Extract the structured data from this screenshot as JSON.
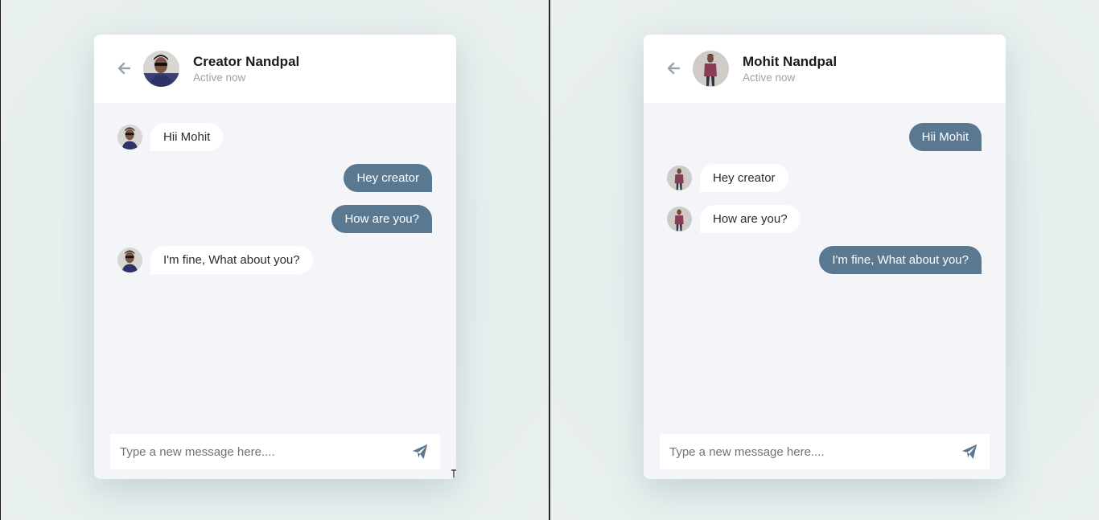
{
  "colors": {
    "outgoing_bubble": "#5b7891",
    "incoming_bubble": "#ffffff",
    "chat_background": "#f3f5f8",
    "accent_icon": "#5b7891"
  },
  "panels": [
    {
      "header": {
        "back_icon": "arrow-left-icon",
        "name": "Creator Nandpal",
        "status": "Active now"
      },
      "messages": [
        {
          "text": "Hii Mohit",
          "direction": "in"
        },
        {
          "text": "Hey creator",
          "direction": "out"
        },
        {
          "text": "How are you?",
          "direction": "out"
        },
        {
          "text": "I'm fine, What about you?",
          "direction": "in"
        }
      ],
      "composer": {
        "placeholder": "Type a new message here....",
        "value": "",
        "send_icon": "paper-plane-icon"
      }
    },
    {
      "header": {
        "back_icon": "arrow-left-icon",
        "name": "Mohit Nandpal",
        "status": "Active now"
      },
      "messages": [
        {
          "text": "Hii Mohit",
          "direction": "out"
        },
        {
          "text": "Hey creator",
          "direction": "in"
        },
        {
          "text": "How are you?",
          "direction": "in"
        },
        {
          "text": "I'm fine, What about you?",
          "direction": "out"
        }
      ],
      "composer": {
        "placeholder": "Type a new message here....",
        "value": "",
        "send_icon": "paper-plane-icon"
      }
    }
  ]
}
